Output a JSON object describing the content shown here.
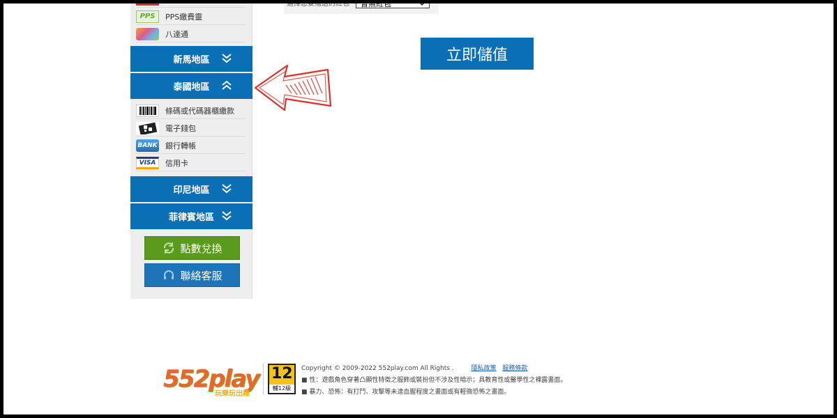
{
  "top": {
    "select_label": "選擇您要贈送的紅包",
    "select_value": "暫無紅包"
  },
  "main": {
    "deposit_button": "立即儲值"
  },
  "sidebar": {
    "top_methods": [
      {
        "label": "PPS繳費靈",
        "icon": "pps-icon"
      },
      {
        "label": "八達通",
        "icon": "octopus-card-icon"
      }
    ],
    "regions": [
      {
        "label": "新馬地區",
        "state": "collapsed"
      },
      {
        "label": "泰國地區",
        "state": "expanded"
      },
      {
        "label": "印尼地區",
        "state": "collapsed"
      },
      {
        "label": "菲律賓地區",
        "state": "collapsed"
      }
    ],
    "thai_methods": [
      {
        "label": "條碼或代碼器櫃繳款",
        "icon": "barcode-icon"
      },
      {
        "label": "電子錢包",
        "icon": "qr-wallet-icon"
      },
      {
        "label": "銀行轉帳",
        "icon": "bank-icon",
        "icon_text": "BANK"
      },
      {
        "label": "信用卡",
        "icon": "visa-icon",
        "icon_text": "VISA"
      }
    ],
    "points_button": "點數兌換",
    "support_button": "聯絡客服",
    "pps_icon_text": "PPS"
  },
  "footer": {
    "logo_text": "552play",
    "logo_tagline": "玩樂玩出趣",
    "rating_number": "12",
    "rating_label": "輔12級",
    "copyright": "Copyright © 2009-2022 552play.com All Rights .",
    "privacy_link": "隱私政策",
    "terms_link": "服務條款",
    "rating_line1": "■ 性：遊戲角色穿著凸顯性特徵之服飾或裝扮但不涉及性暗示；具教育性或醫學性之裸露畫面。",
    "rating_line2": "■ 暴力、恐怖：有打鬥、攻擊等未達血腥程度之畫面或有輕微恐怖之畫面。"
  },
  "colors": {
    "region_blue": "#0b6fb6",
    "points_green": "#5a9a1c",
    "support_blue": "#1d74b8",
    "arrow_red": "#d9322b"
  }
}
